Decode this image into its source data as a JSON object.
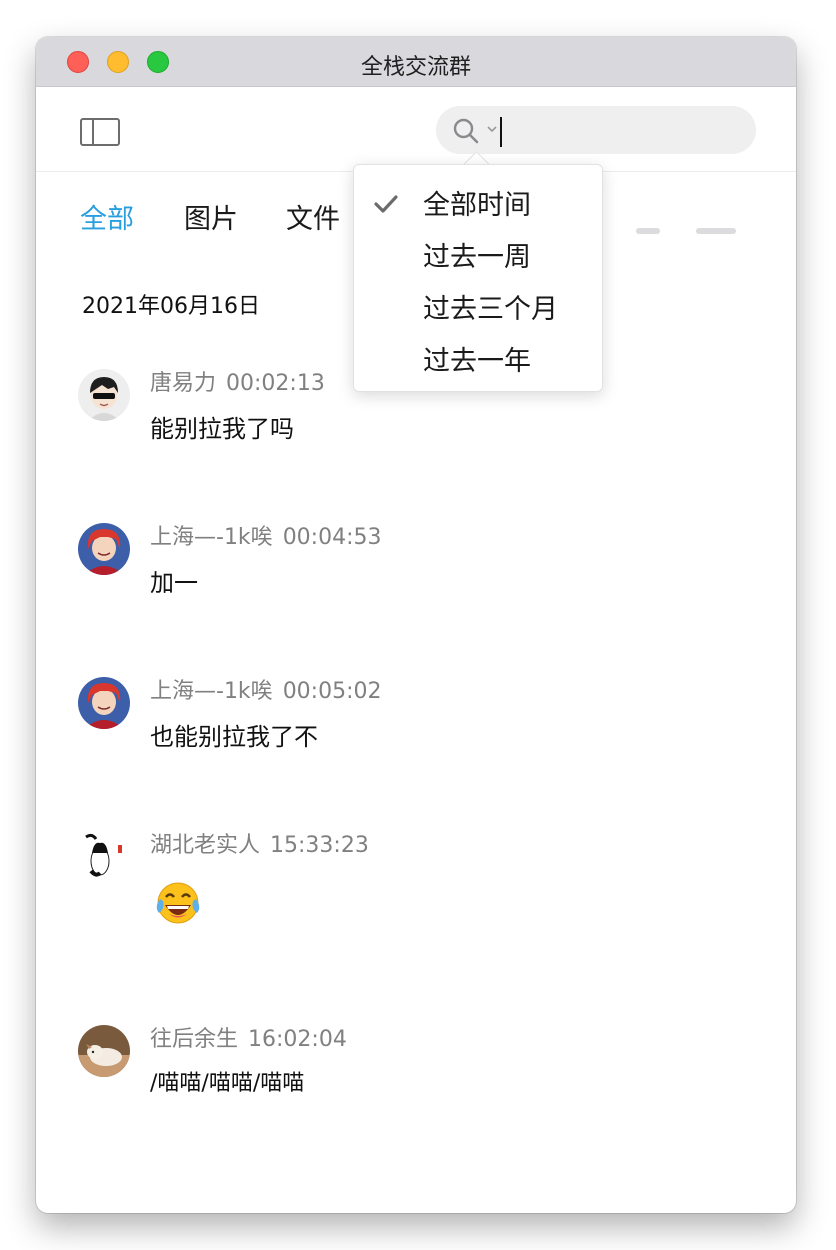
{
  "window": {
    "title": "全栈交流群"
  },
  "search": {
    "value": ""
  },
  "tabs": [
    {
      "label": "全部",
      "active": true
    },
    {
      "label": "图片",
      "active": false
    },
    {
      "label": "文件",
      "active": false
    }
  ],
  "date_heading": "2021年06月16日",
  "messages": [
    {
      "sender": "唐易力",
      "time": "00:02:13",
      "text": "能别拉我了吗",
      "avatar_icon": "sunglasses-boy-avatar-icon"
    },
    {
      "sender": "上海—-1k唉",
      "time": "00:04:53",
      "text": "加一",
      "avatar_icon": "red-hair-anime-avatar-icon"
    },
    {
      "sender": "上海—-1k唉",
      "time": "00:05:02",
      "text": "也能别拉我了不",
      "avatar_icon": "red-hair-anime-avatar-icon"
    },
    {
      "sender": "湖北老实人",
      "time": "15:33:23",
      "text": "",
      "emoji": "tears-of-joy-emoji",
      "avatar_icon": "ink-cat-avatar-icon"
    },
    {
      "sender": "往后余生",
      "time": "16:02:04",
      "text": "/喵喵/喵喵/喵喵",
      "avatar_icon": "puppy-photo-avatar-icon"
    }
  ],
  "time_filter_menu": {
    "items": [
      {
        "label": "全部时间",
        "checked": true
      },
      {
        "label": "过去一周",
        "checked": false
      },
      {
        "label": "过去三个月",
        "checked": false
      },
      {
        "label": "过去一年",
        "checked": false
      }
    ]
  },
  "colors": {
    "accent": "#2a9fe0",
    "meta_text": "#808080",
    "titlebar": "#d9d8dc"
  }
}
